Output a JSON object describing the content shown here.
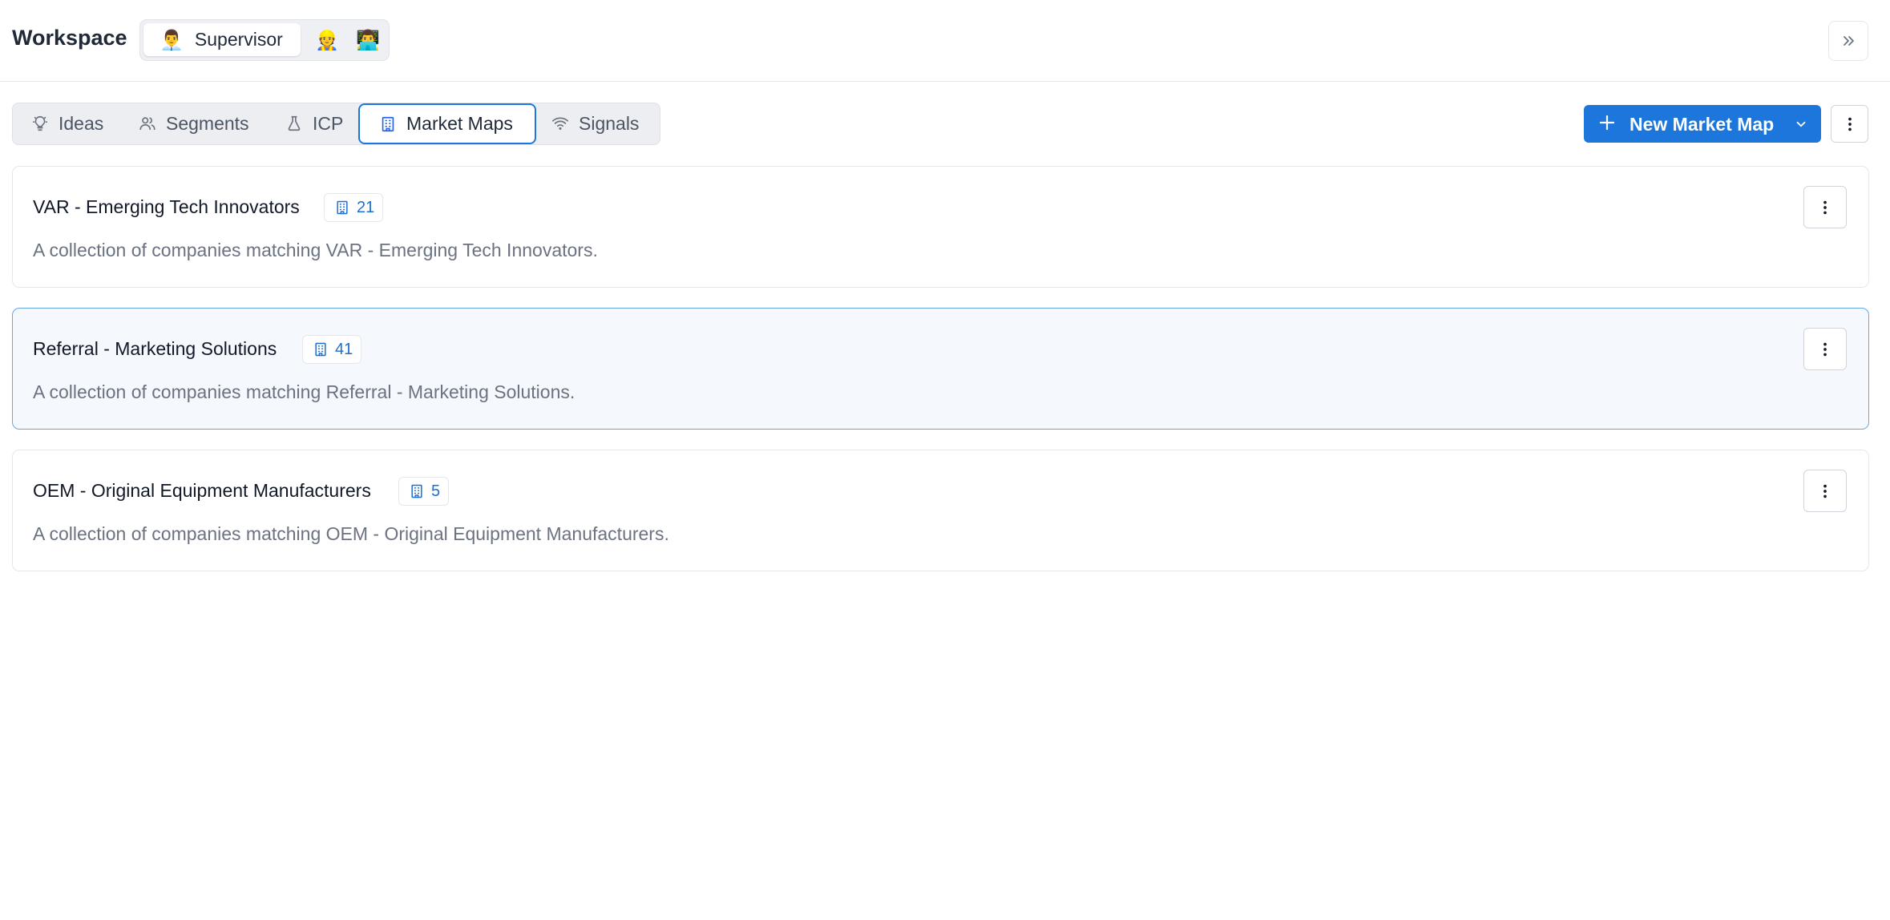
{
  "header": {
    "title": "Workspace",
    "personas": [
      {
        "emoji": "👨‍💼",
        "label": "Supervisor",
        "active": true
      },
      {
        "emoji": "👷",
        "label": ""
      },
      {
        "emoji": "👨‍💻",
        "label": ""
      }
    ],
    "collapse_icon": "double-chevron-right-icon"
  },
  "tabs": [
    {
      "label": "Ideas",
      "icon": "lightbulb-icon"
    },
    {
      "label": "Segments",
      "icon": "users-icon"
    },
    {
      "label": "ICP",
      "icon": "flask-icon"
    },
    {
      "label": "Market Maps",
      "icon": "building-icon",
      "active": true
    },
    {
      "label": "Signals",
      "icon": "wifi-icon"
    }
  ],
  "actions": {
    "new_button_label": "New Market Map",
    "accent_color": "#1d76db"
  },
  "market_maps": [
    {
      "title": "VAR - Emerging Tech Innovators",
      "count": "21",
      "description": "A collection of companies matching VAR - Emerging Tech Innovators."
    },
    {
      "title": "Referral - Marketing Solutions",
      "count": "41",
      "description": "A collection of companies matching Referral - Marketing Solutions.",
      "selected": true
    },
    {
      "title": "OEM - Original Equipment Manufacturers",
      "count": "5",
      "description": "A collection of companies matching OEM - Original Equipment Manufacturers."
    }
  ]
}
